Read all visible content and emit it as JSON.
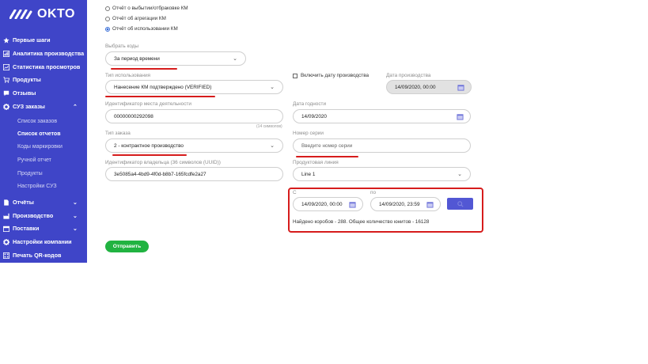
{
  "brand": {
    "logo_text": "OKTO"
  },
  "sidebar": {
    "items": [
      {
        "label": "Первые шаги",
        "icon": "star-icon"
      },
      {
        "label": "Аналитика производства",
        "icon": "analytics-icon"
      },
      {
        "label": "Статистика просмотров",
        "icon": "stats-icon"
      },
      {
        "label": "Продукты",
        "icon": "cart-icon"
      },
      {
        "label": "Отзывы",
        "icon": "comment-icon"
      },
      {
        "label": "СУЗ заказы",
        "icon": "gear-icon"
      },
      {
        "label": "Отчёты",
        "icon": "doc-icon"
      },
      {
        "label": "Производство",
        "icon": "factory-icon"
      },
      {
        "label": "Поставки",
        "icon": "box-icon"
      },
      {
        "label": "Настройки компании",
        "icon": "settings-icon"
      },
      {
        "label": "Печать QR-кодов",
        "icon": "print-icon"
      }
    ],
    "sub_items": [
      "Список заказов",
      "Список отчетов",
      "Коды маркировки",
      "Ручной отчет",
      "Продукты",
      "Настройки СУЗ"
    ]
  },
  "report_type": {
    "options": [
      "Отчёт о выбытии/отбраковке КМ",
      "Отчёт об агрегации КМ",
      "Отчёт об использовании КМ"
    ],
    "selected": 2
  },
  "form": {
    "codes": {
      "label": "Выбрать коды",
      "value": "За период времени"
    },
    "usage_type": {
      "label": "Тип использования",
      "value": "Нанесение КМ подтверждено (VERIFIED)"
    },
    "include_date_label": "Включить дату производства",
    "production_date": {
      "label": "Дата производства",
      "value": "14/09/2020, 00:00"
    },
    "activity_place": {
      "label": "Идентификатор места деятельности",
      "value": "00000000292098",
      "hint": "(14 символов)"
    },
    "expiry_date": {
      "label": "Дата годности",
      "value": "14/09/2020"
    },
    "order_type": {
      "label": "Тип заказа",
      "value": "2 - контрактное производство"
    },
    "series_number": {
      "label": "Номер серии",
      "placeholder": "Введите номер серии"
    },
    "owner_id": {
      "label": "Идентификатор владельца (36 символов (UUID))",
      "value": "3e5085a4-4bd9-4f0d-b8b7-165fcdfe2a27"
    },
    "product_line": {
      "label": "Продуктовая линия",
      "value": "Line 1"
    },
    "period": {
      "from_label": "С",
      "from_value": "14/09/2020, 00:00",
      "to_label": "по",
      "to_value": "14/09/2020, 23:59"
    },
    "result_text": "Найдено коробов - 288. Общее количество юнитов - 16128",
    "submit_label": "Отправить"
  },
  "colors": {
    "sidebar": "#3f45c8",
    "accent": "#5257d4",
    "submit": "#21b341",
    "annotation": "#d61c1c"
  }
}
